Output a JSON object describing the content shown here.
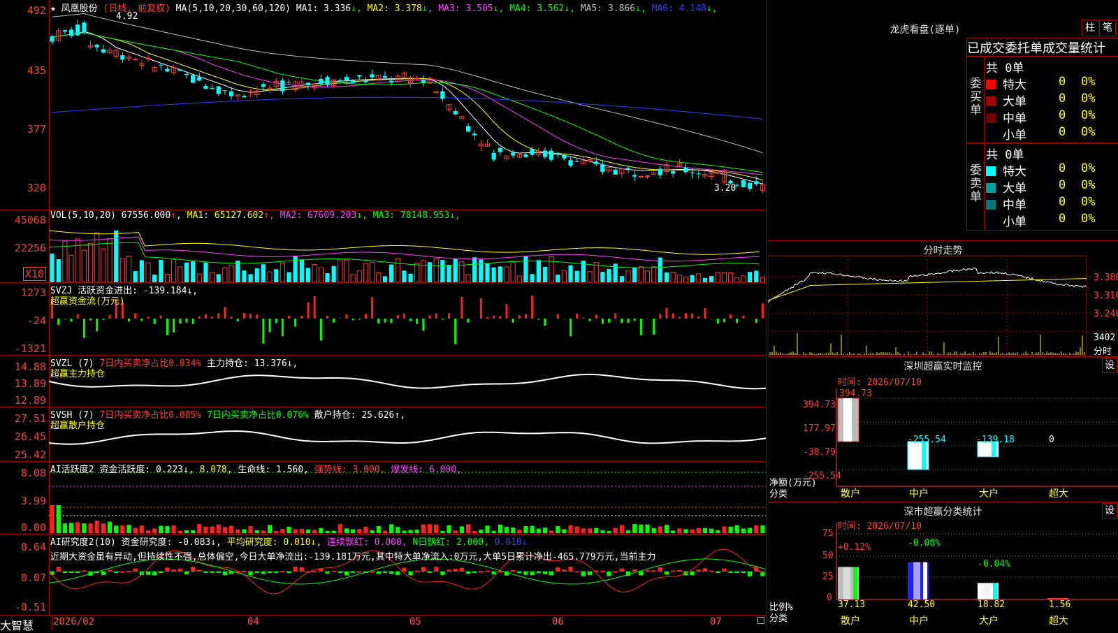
{
  "stock": {
    "name": "凤凰股份",
    "mode": "(日线, 前复权)",
    "star": "★"
  },
  "ma": {
    "label": "MA(5,10,20,30,60,120)",
    "items": [
      {
        "name": "MA1:",
        "value": "3.336",
        "arrow": "↓",
        "color": "#ffffff"
      },
      {
        "name": "MA2:",
        "value": "3.378",
        "arrow": "↓",
        "color": "#ffff00"
      },
      {
        "name": "MA3:",
        "value": "3.505",
        "arrow": "↓",
        "color": "#ff3cff"
      },
      {
        "name": "MA4:",
        "value": "3.562",
        "arrow": "↓",
        "color": "#00ff00"
      },
      {
        "name": "MA5:",
        "value": "3.866",
        "arrow": "↓",
        "color": "#c0c0c0"
      },
      {
        "name": "MA6:",
        "value": "4.148",
        "arrow": "↓",
        "color": "#3a3aff"
      }
    ]
  },
  "price_axis": [
    "492",
    "435",
    "377",
    "320"
  ],
  "price_marks": {
    "high": "4.92",
    "low": "3.20"
  },
  "vol": {
    "label": "VOL(5,10,20)",
    "value": "67556.000",
    "arrow": "↑",
    "items": [
      {
        "name": "MA1:",
        "value": "65127.602",
        "arrow": "↑",
        "color": "#ffff00"
      },
      {
        "name": "MA2:",
        "value": "67609.203",
        "arrow": "↓",
        "color": "#ff3cff"
      },
      {
        "name": "MA3:",
        "value": "78148.953",
        "arrow": "↓",
        "color": "#00ff00"
      }
    ],
    "axis": [
      "45068",
      "22256"
    ],
    "unit": "X10"
  },
  "svzj": {
    "label": "SVZJ",
    "desc": "活跃资金进出: -139.184↓,",
    "sub": "超赢资金流(万元)",
    "axis": [
      "1273",
      "-24",
      "-1321"
    ]
  },
  "svzl": {
    "label": "SVZL (7)",
    "p1": "7日内买卖净占比0.034%",
    "p2": "主力持仓: 13.376↓,",
    "sub": "超赢主力持仓",
    "axis": [
      "14.88",
      "13.89",
      "12.89"
    ]
  },
  "svsh": {
    "label": "SVSH (7)",
    "p1": "7日内买卖净占比0.085%",
    "p2": "7日内买卖净占比0.076%",
    "p3": "散户持仓: 25.626↑,",
    "sub": "超赢散户持仓",
    "axis": [
      "27.51",
      "26.45",
      "25.42"
    ]
  },
  "ai1": {
    "label": "AI活跃度2",
    "p1": "资金活跃度: 0.223↓,",
    "p2": "8.078,",
    "p3": "生命线: 1.560,",
    "p4": "强势线: 3.000,",
    "p5": "爆发线: 6.000,",
    "axis": [
      "8.08",
      "3.99",
      "0.00"
    ]
  },
  "ai2": {
    "label": "AI研究度2(10)",
    "p1": "资金研究度: -0.083↓,",
    "p2": "平均研究度: 0.010↓,",
    "p3": "连续飘红: 0.000,",
    "p4": "N日飘红: 2.000,",
    "p5": "0.010↓",
    "text": "近期大资金虽有异动,但持续性不强,总体偏空,今日大单净流出:-139.181万元,其中特大单净流入:0万元,大单5日累计净出-465.779万元,当前主力",
    "axis": [
      "0.64",
      "0.07",
      "-0.51"
    ]
  },
  "xaxis": [
    "2026/02",
    "04",
    "05",
    "06",
    "07"
  ],
  "brand": "大智慧",
  "dragon": {
    "title": "龙虎看盘(逐单)",
    "btn1": "柱",
    "btn2": "笔",
    "header": "已成交委托单成交量统计",
    "buy": {
      "side": "委买单",
      "total": "共 0单",
      "rows": [
        {
          "label": "特大",
          "v": "0",
          "p": "0%",
          "color": "#ff0000"
        },
        {
          "label": "大单",
          "v": "0",
          "p": "0%",
          "color": "#a00000"
        },
        {
          "label": "中单",
          "v": "0",
          "p": "0%",
          "color": "#700000"
        },
        {
          "label": "小单",
          "v": "0",
          "p": "0%",
          "color": "#000000"
        }
      ]
    },
    "sell": {
      "side": "委卖单",
      "total": "共 0单",
      "rows": [
        {
          "label": "特大",
          "v": "0",
          "p": "0%",
          "color": "#00ffff"
        },
        {
          "label": "大单",
          "v": "0",
          "p": "0%",
          "color": "#00a0a0"
        },
        {
          "label": "中单",
          "v": "0",
          "p": "0%",
          "color": "#007878"
        },
        {
          "label": "小单",
          "v": "0",
          "p": "0%",
          "color": "#000000"
        }
      ]
    }
  },
  "intraday": {
    "title": "分时走势",
    "axis": [
      "3.380",
      "3.310",
      "3.240"
    ],
    "vol_max": "3402",
    "vol_label": "分时"
  },
  "monitor": {
    "title": "深圳超赢实时监控",
    "btn": "设",
    "time": "时间: 2026/07/10",
    "axis": [
      "394.73",
      "177.97",
      "-38.79",
      "-255.54"
    ],
    "ylabel": "净额(万元)",
    "xlabel": "分类",
    "cats": [
      "散户",
      "中户",
      "大户",
      "超大"
    ],
    "values": [
      394.73,
      -255.54,
      -139.18,
      0
    ],
    "labels": [
      "394.73",
      "-255.54",
      "-139.18",
      "0"
    ]
  },
  "classify": {
    "title": "深市超赢分类统计",
    "btn": "设",
    "time": "时间: 2026/07/10",
    "axis": [
      "75",
      "50",
      "25",
      "0"
    ],
    "ylabel": "比例%",
    "xlabel": "分类",
    "cats": [
      "散户",
      "中户",
      "大户",
      "超大"
    ],
    "values": [
      37.13,
      42.5,
      18.82,
      1.56
    ],
    "vlabels": [
      "37.13",
      "42.50",
      "18.82",
      "1.56"
    ],
    "deltas": [
      "+0.12%",
      "-0.08%",
      "-0.04%",
      ""
    ]
  }
}
